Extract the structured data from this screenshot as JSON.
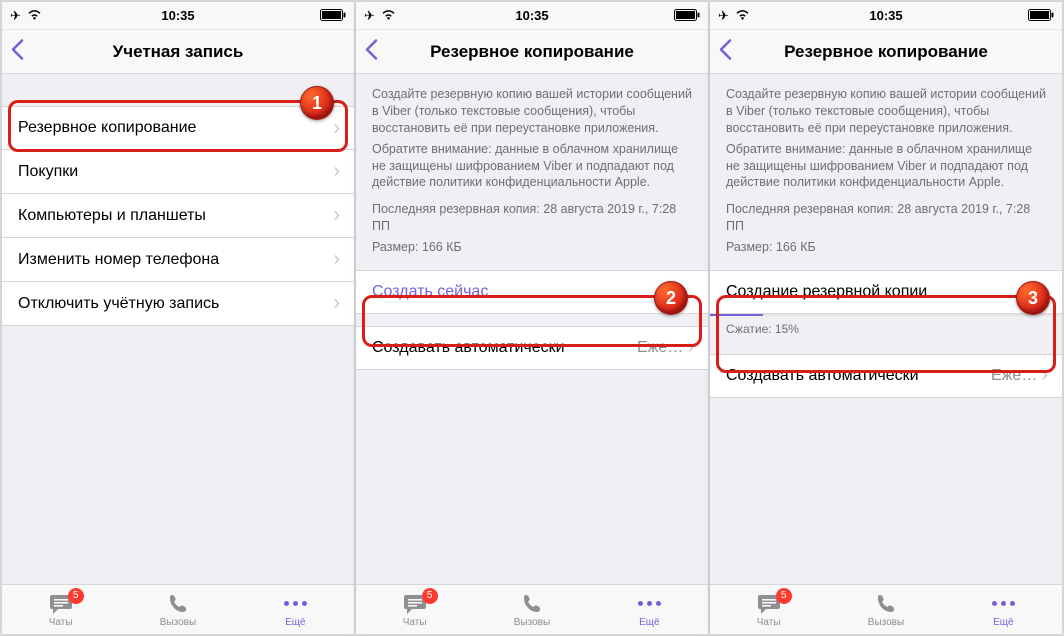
{
  "status": {
    "time": "10:35"
  },
  "screen1": {
    "title": "Учетная запись",
    "items": [
      {
        "label": "Резервное копирование"
      },
      {
        "label": "Покупки"
      },
      {
        "label": "Компьютеры и планшеты"
      },
      {
        "label": "Изменить номер телефона"
      },
      {
        "label": "Отключить учётную запись"
      }
    ]
  },
  "screen2": {
    "title": "Резервное копирование",
    "info_p1": "Создайте резервную копию вашей истории сообщений в Viber (только текстовые сообщения), чтобы восстановить её при переустановке приложения.",
    "info_p2": "Обратите внимание: данные в облачном хранилище не защищены шифрованием Viber и подпадают под действие политики конфиденциальности Apple.",
    "meta_line1": "Последняя резервная копия: 28 августа 2019 г., 7:28 ПП",
    "meta_line2": "Размер: 166 КБ",
    "create_now": "Создать сейчас",
    "auto_label": "Создавать автоматически",
    "auto_value": "Еже…"
  },
  "screen3": {
    "title": "Резервное копирование",
    "progress_label": "Создание резервной копии",
    "progress_sub": "Сжатие: 15%",
    "progress_pct": 15,
    "auto_label": "Создавать автоматически",
    "auto_value": "Еже…"
  },
  "tabs": {
    "chats": "Чаты",
    "calls": "Вызовы",
    "more": "Ещё",
    "badge": "5"
  },
  "markers": {
    "one": "1",
    "two": "2",
    "three": "3"
  }
}
